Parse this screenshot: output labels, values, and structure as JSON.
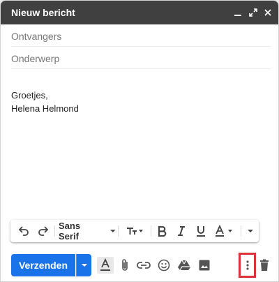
{
  "window": {
    "title": "Nieuw bericht",
    "controls": [
      "minimize-icon",
      "expand-icon",
      "close-icon"
    ]
  },
  "fields": {
    "recipients_placeholder": "Ontvangers",
    "subject_placeholder": "Onderwerp"
  },
  "body": {
    "lines": [
      "Groetjes,",
      "Helena Helmond"
    ]
  },
  "format_toolbar": {
    "font_name": "Sans Serif",
    "items": [
      "undo-icon",
      "redo-icon",
      "font-select",
      "text-size-icon",
      "bold-icon",
      "italic-icon",
      "underline-icon",
      "text-color-icon",
      "more-formatting-icon"
    ]
  },
  "bottom_bar": {
    "send_label": "Verzenden",
    "icons": [
      "formatting-options-icon",
      "attach-icon",
      "link-icon",
      "emoji-icon",
      "drive-icon",
      "photo-icon",
      "more-options-icon",
      "delete-icon"
    ]
  },
  "colors": {
    "header_bg": "#404040",
    "send_button": "#1a73e8",
    "highlight": "#d93437"
  }
}
